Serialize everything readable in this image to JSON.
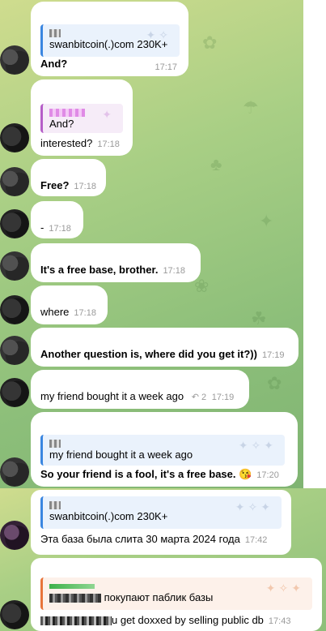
{
  "messages": [
    {
      "quote": {
        "text": "swanbitcoin(.)com  230K+"
      },
      "text": "And?",
      "time": "17:17"
    },
    {
      "quote": {
        "text": "And?"
      },
      "text": "interested?",
      "time": "17:18"
    },
    {
      "text": "Free?",
      "time": "17:18"
    },
    {
      "text": "-",
      "time": "17:18"
    },
    {
      "text": "It's a free base, brother.",
      "time": "17:18"
    },
    {
      "text": "where",
      "time": "17:18"
    },
    {
      "text": "Another question is, where did you get it?))",
      "time": "17:19"
    },
    {
      "text": "my friend  bought it a week ago",
      "replies": "2",
      "time": "17:19"
    },
    {
      "quote": {
        "text": "my friend  bought it a week ago"
      },
      "text": "So your friend is a fool, it's a free base. 😘",
      "time": "17:20"
    },
    {
      "quote": {
        "text": "swanbitcoin(.)com  230K+"
      },
      "text": "Эта база была слита 30 марта 2024 года",
      "time": "17:42"
    },
    {
      "quote": {
        "text": "покупают паблик базы"
      },
      "text": "u get doxxed by selling public db",
      "time": "17:43"
    }
  ],
  "colors": {
    "accent": "#3a86e0",
    "quote_purple": "#b55ec8",
    "quote_orange": "#e8743a",
    "time": "#9a9a9a"
  }
}
